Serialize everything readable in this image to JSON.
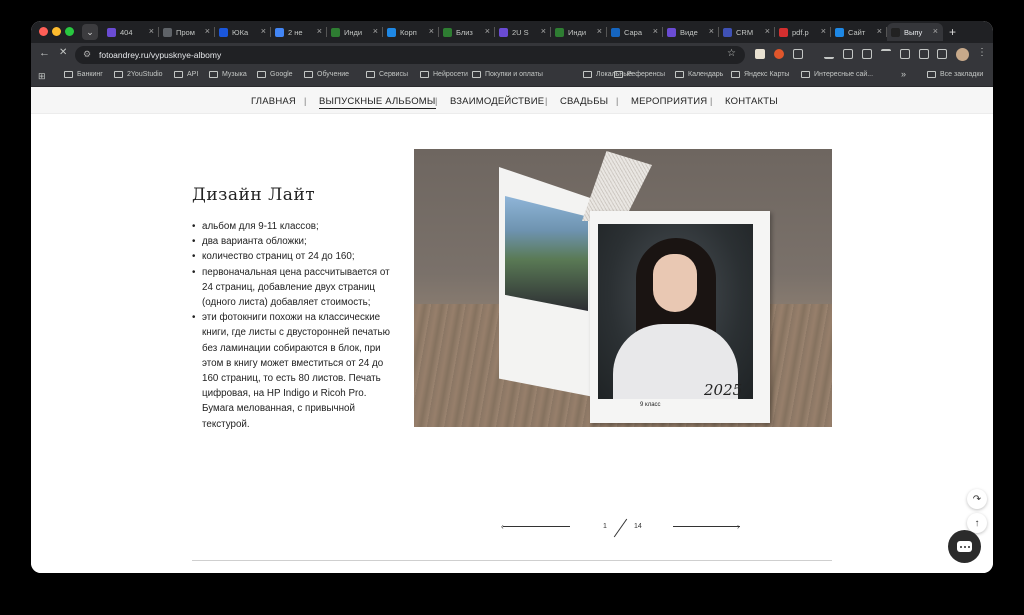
{
  "browser": {
    "tabs": [
      {
        "label": "404",
        "color": "#6a4bd3"
      },
      {
        "label": "Пром",
        "color": "#5f6368"
      },
      {
        "label": "ЮКа",
        "color": "#1a56db"
      },
      {
        "label": "2 не",
        "color": "#4285f4"
      },
      {
        "label": "Инди",
        "color": "#2e7d32"
      },
      {
        "label": "Корп",
        "color": "#1e88e5"
      },
      {
        "label": "Близ",
        "color": "#2e7d32"
      },
      {
        "label": "2U S",
        "color": "#6a4bd3"
      },
      {
        "label": "Инди",
        "color": "#2e7d32"
      },
      {
        "label": "Сара",
        "color": "#1565c0"
      },
      {
        "label": "Виде",
        "color": "#6a4bd3"
      },
      {
        "label": "CRM",
        "color": "#3f51b5"
      },
      {
        "label": "pdf.p",
        "color": "#d32f2f"
      },
      {
        "label": "Сайт",
        "color": "#1e88e5"
      },
      {
        "label": "Выпу",
        "color": "#222222"
      }
    ],
    "url": "fotoandrey.ru/vypusknye-albomy",
    "bookmarks": [
      "Банкинг",
      "2YouStudio",
      "API",
      "Музыка",
      "Google",
      "Обучение",
      "Сервисы",
      "Нейросети",
      "Покупки и оплаты",
      "Локальные",
      "Референсы",
      "Календарь",
      "Яндекс Карты",
      "Интересные сай..."
    ],
    "bookmarks_more": "»",
    "all_bookmarks": "Все закладки"
  },
  "site_nav": [
    "ГЛАВНАЯ",
    "ВЫПУСКНЫЕ АЛЬБОМЫ",
    "ВЗАИМОДЕЙСТВИЕ",
    "СВАДЬБЫ",
    "МЕРОПРИЯТИЯ",
    "КОНТАКТЫ"
  ],
  "product": {
    "title": "Дизайн Лайт",
    "bullets": [
      "альбом для 9-11 классов;",
      "два варианта обложки;",
      "количество страниц от 24 до 160;",
      "первоначальная цена рассчитывается от 24 страниц, добавление двух страниц (одного листа) добавляет стоимость;",
      "эти фотокниги похожи на классические книги, где листы с двусторонней печатью без ламинации собираются в блок, при этом в книгу может вместиться от 24 до 160 страниц, то есть 80 листов. Печать цифровая, на HP Indigo и Ricoh Pro. Бумага мелованная, с привычной текстурой."
    ],
    "cover_year": "2025",
    "cover_class": "9 класс"
  },
  "slider": {
    "current": "1",
    "total": "14"
  }
}
